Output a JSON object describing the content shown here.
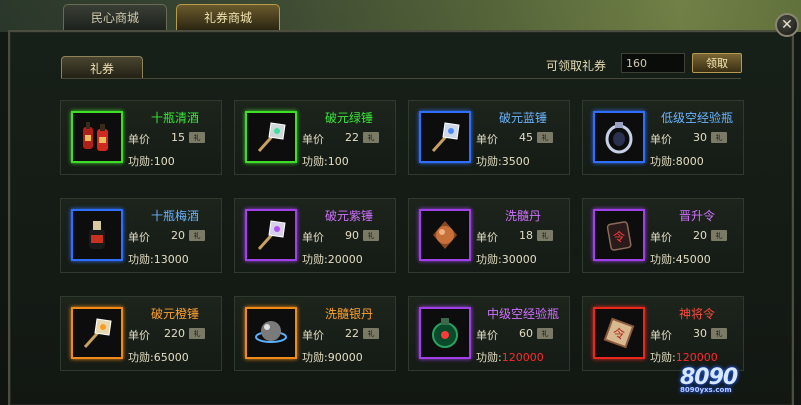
{
  "tabs": [
    {
      "label": "民心商城"
    },
    {
      "label": "礼券商城"
    }
  ],
  "close_label": "✕",
  "sub_tab": "礼券",
  "coupon": {
    "label": "可领取礼券",
    "value": "160",
    "claim_label": "领取"
  },
  "card_labels": {
    "price": "单价",
    "merit": "功勋:",
    "currency": "礼"
  },
  "items": [
    {
      "name": "十瓶清酒",
      "name_color": "#38e838",
      "border": "#3fdc2a",
      "price": "15",
      "merit": "100",
      "merit_red": false,
      "icon": "wine-bottles-icon"
    },
    {
      "name": "破元绿锤",
      "name_color": "#38e838",
      "border": "#3fdc2a",
      "price": "22",
      "merit": "100",
      "merit_red": false,
      "icon": "green-hammer-icon"
    },
    {
      "name": "破元蓝锤",
      "name_color": "#6ab4ff",
      "border": "#2f6fff",
      "price": "45",
      "merit": "3500",
      "merit_red": false,
      "icon": "blue-hammer-icon"
    },
    {
      "name": "低级空经验瓶",
      "name_color": "#6ab4ff",
      "border": "#2f6fff",
      "price": "30",
      "merit": "8000",
      "merit_red": false,
      "icon": "exp-bottle-icon"
    },
    {
      "name": "十瓶梅酒",
      "name_color": "#6ab4ff",
      "border": "#2f6fff",
      "price": "20",
      "merit": "13000",
      "merit_red": false,
      "icon": "plum-wine-icon"
    },
    {
      "name": "破元紫锤",
      "name_color": "#d070ff",
      "border": "#a040e8",
      "price": "90",
      "merit": "20000",
      "merit_red": false,
      "icon": "purple-hammer-icon"
    },
    {
      "name": "洗髓丹",
      "name_color": "#d070ff",
      "border": "#a040e8",
      "price": "18",
      "merit": "30000",
      "merit_red": false,
      "icon": "pill-icon"
    },
    {
      "name": "晋升令",
      "name_color": "#d070ff",
      "border": "#a040e8",
      "price": "20",
      "merit": "45000",
      "merit_red": false,
      "icon": "promotion-token-icon"
    },
    {
      "name": "破元橙锤",
      "name_color": "#ffa030",
      "border": "#f08a18",
      "price": "220",
      "merit": "65000",
      "merit_red": false,
      "icon": "orange-hammer-icon"
    },
    {
      "name": "洗髓银丹",
      "name_color": "#ffa030",
      "border": "#f08a18",
      "price": "22",
      "merit": "90000",
      "merit_red": false,
      "icon": "silver-pill-icon"
    },
    {
      "name": "中级空经验瓶",
      "name_color": "#d070ff",
      "border": "#a040e8",
      "price": "60",
      "merit": "120000",
      "merit_red": true,
      "icon": "mid-exp-bottle-icon"
    },
    {
      "name": "神将令",
      "name_color": "#ff4a3a",
      "border": "#e8281c",
      "price": "30",
      "merit": "120000",
      "merit_red": true,
      "icon": "general-token-icon"
    }
  ],
  "watermark": {
    "text": "8090",
    "sub": "8090yxs.com"
  }
}
